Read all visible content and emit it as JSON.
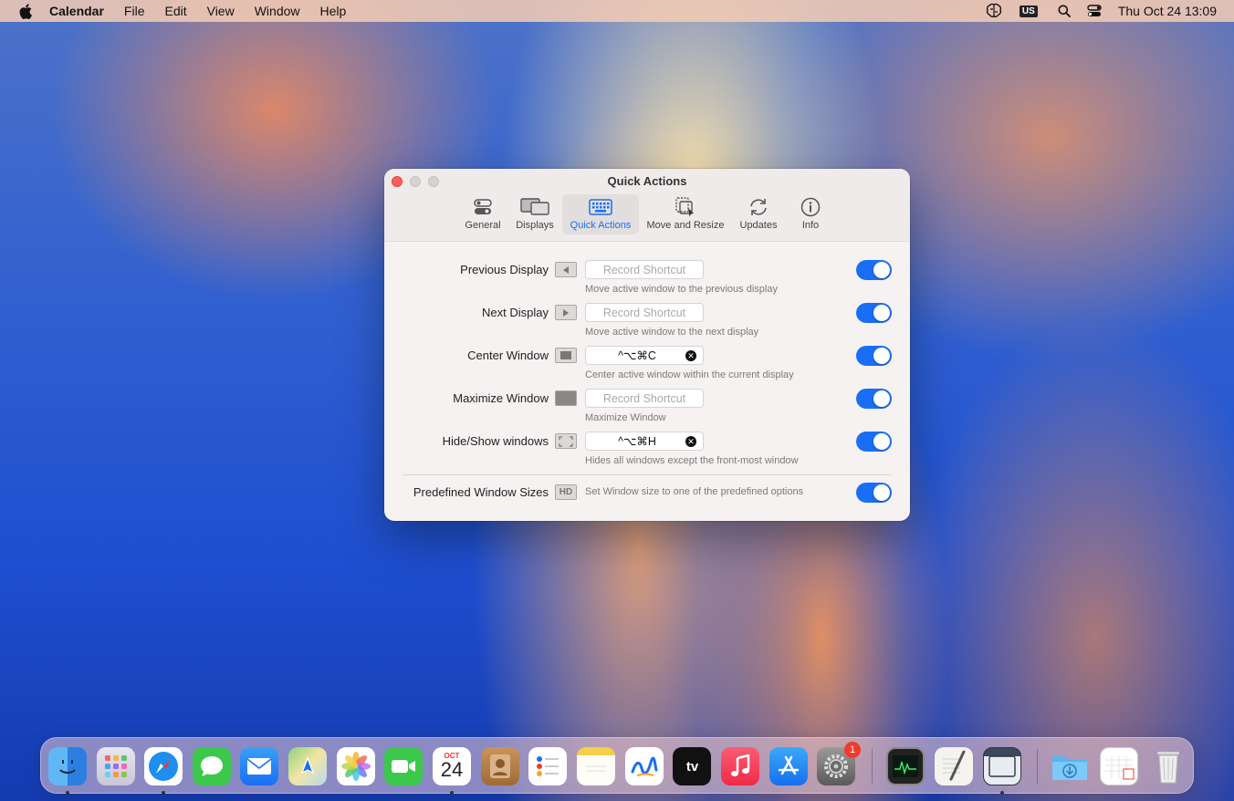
{
  "menubar": {
    "app_name": "Calendar",
    "items": [
      "File",
      "Edit",
      "View",
      "Window",
      "Help"
    ],
    "input_source": "US",
    "datetime": "Thu Oct 24  13:09"
  },
  "window": {
    "title": "Quick Actions",
    "tabs": [
      {
        "label": "General",
        "icon": "toggles-icon"
      },
      {
        "label": "Displays",
        "icon": "displays-icon"
      },
      {
        "label": "Quick Actions",
        "icon": "keyboard-icon",
        "active": true
      },
      {
        "label": "Move and Resize",
        "icon": "move-resize-icon"
      },
      {
        "label": "Updates",
        "icon": "refresh-icon"
      },
      {
        "label": "Info",
        "icon": "info-icon"
      }
    ],
    "rows": [
      {
        "label": "Previous Display",
        "icon": "previous-display-icon",
        "shortcut": "",
        "placeholder": "Record Shortcut",
        "description": "Move active window to the previous display",
        "enabled": true
      },
      {
        "label": "Next Display",
        "icon": "next-display-icon",
        "shortcut": "",
        "placeholder": "Record Shortcut",
        "description": "Move active window to the next display",
        "enabled": true
      },
      {
        "label": "Center Window",
        "icon": "center-window-icon",
        "shortcut": "^⌥⌘C",
        "placeholder": "Record Shortcut",
        "description": "Center active window within the current display",
        "enabled": true
      },
      {
        "label": "Maximize Window",
        "icon": "maximize-window-icon",
        "shortcut": "",
        "placeholder": "Record Shortcut",
        "description": "Maximize Window",
        "enabled": true
      },
      {
        "label": "Hide/Show windows",
        "icon": "hide-show-icon",
        "shortcut": "^⌥⌘H",
        "placeholder": "Record Shortcut",
        "description": "Hides all windows except the front-most window",
        "enabled": true
      }
    ],
    "predefined": {
      "label": "Predefined Window Sizes",
      "icon_text": "HD",
      "description": "Set Window size to one of the predefined options",
      "enabled": true
    }
  },
  "dock": {
    "calendar_month": "OCT",
    "calendar_day": "24",
    "settings_badge": "1",
    "apps": [
      "Finder",
      "Launchpad",
      "Safari",
      "Messages",
      "Mail",
      "Maps",
      "Photos",
      "FaceTime",
      "Calendar",
      "Contacts",
      "Reminders",
      "Notes",
      "Freeform",
      "TV",
      "Music",
      "App Store",
      "System Settings",
      "Activity Monitor",
      "TextEdit",
      "App Window",
      "Downloads",
      "Calendar File",
      "Trash"
    ],
    "tv_label": "tv"
  }
}
